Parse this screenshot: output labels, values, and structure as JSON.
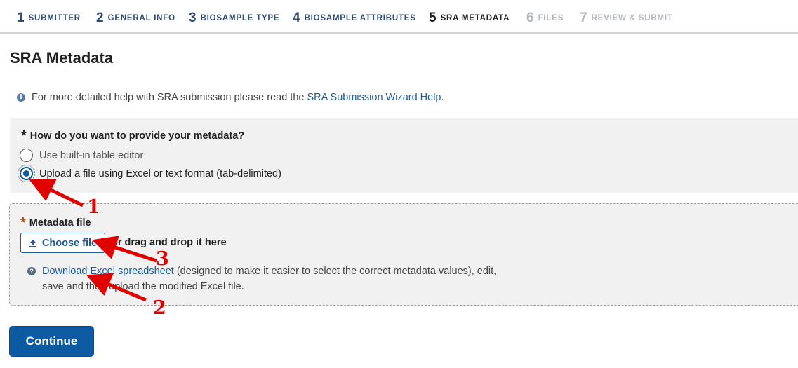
{
  "stepbar": {
    "steps": [
      {
        "num": "1",
        "label": "SUBMITTER",
        "state": "done"
      },
      {
        "num": "2",
        "label": "GENERAL INFO",
        "state": "done"
      },
      {
        "num": "3",
        "label": "BIOSAMPLE TYPE",
        "state": "done"
      },
      {
        "num": "4",
        "label": "BIOSAMPLE ATTRIBUTES",
        "state": "done"
      },
      {
        "num": "5",
        "label": "SRA METADATA",
        "state": "active"
      },
      {
        "num": "6",
        "label": "FILES",
        "state": "future"
      },
      {
        "num": "7",
        "label": "REVIEW & SUBMIT",
        "state": "future"
      }
    ]
  },
  "page": {
    "title": "SRA Metadata",
    "help_prefix": "For more detailed help with SRA submission please read the",
    "help_link": "SRA Submission Wizard Help",
    "help_suffix": "."
  },
  "metadata_choice": {
    "question": "How do you want to provide your metadata?",
    "options": [
      {
        "label": "Use built-in table editor",
        "checked": false
      },
      {
        "label": "Upload a file using Excel or text format (tab-delimited)",
        "checked": true
      }
    ]
  },
  "upload": {
    "label": "Metadata file",
    "choose_button": "Choose file",
    "drag_text": "or drag and drop it here",
    "download_link": "Download Excel spreadsheet",
    "download_text": "(designed to make it easier to select the correct metadata values), edit, save and then upload the modified Excel file."
  },
  "continue_label": "Continue",
  "annotations": [
    "1",
    "2",
    "3"
  ],
  "colors": {
    "link": "#1d5b9a",
    "primary": "#0b5aa2",
    "step_done_bg": "#dfe1e4",
    "step_active_bg": "#b9bcc1",
    "required_star": "#b4521e",
    "arrow": "#e00000"
  }
}
